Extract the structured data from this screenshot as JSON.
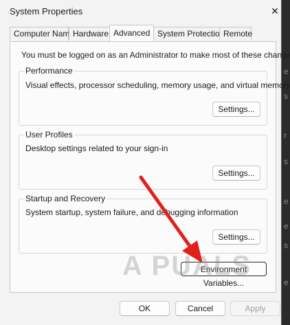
{
  "window": {
    "title": "System Properties",
    "close_glyph": "✕"
  },
  "tabs": [
    {
      "label": "Computer Name",
      "active": false
    },
    {
      "label": "Hardware",
      "active": false
    },
    {
      "label": "Advanced",
      "active": true
    },
    {
      "label": "System Protection",
      "active": false
    },
    {
      "label": "Remote",
      "active": false
    }
  ],
  "admin_note": "You must be logged on as an Administrator to make most of these changes.",
  "groups": {
    "performance": {
      "label": "Performance",
      "description": "Visual effects, processor scheduling, memory usage, and virtual memory",
      "button": "Settings..."
    },
    "user_profiles": {
      "label": "User Profiles",
      "description": "Desktop settings related to your sign-in",
      "button": "Settings..."
    },
    "startup_recovery": {
      "label": "Startup and Recovery",
      "description": "System startup, system failure, and debugging information",
      "button": "Settings..."
    }
  },
  "environment_button": "Environment Variables...",
  "footer": {
    "ok": "OK",
    "cancel": "Cancel",
    "apply": "Apply"
  },
  "watermark": "A PUALS",
  "annotation_arrow_color": "#e0201b",
  "right_strip_glyphs": [
    "e",
    "s",
    "r",
    "s",
    "e",
    "e",
    "s",
    "e"
  ]
}
